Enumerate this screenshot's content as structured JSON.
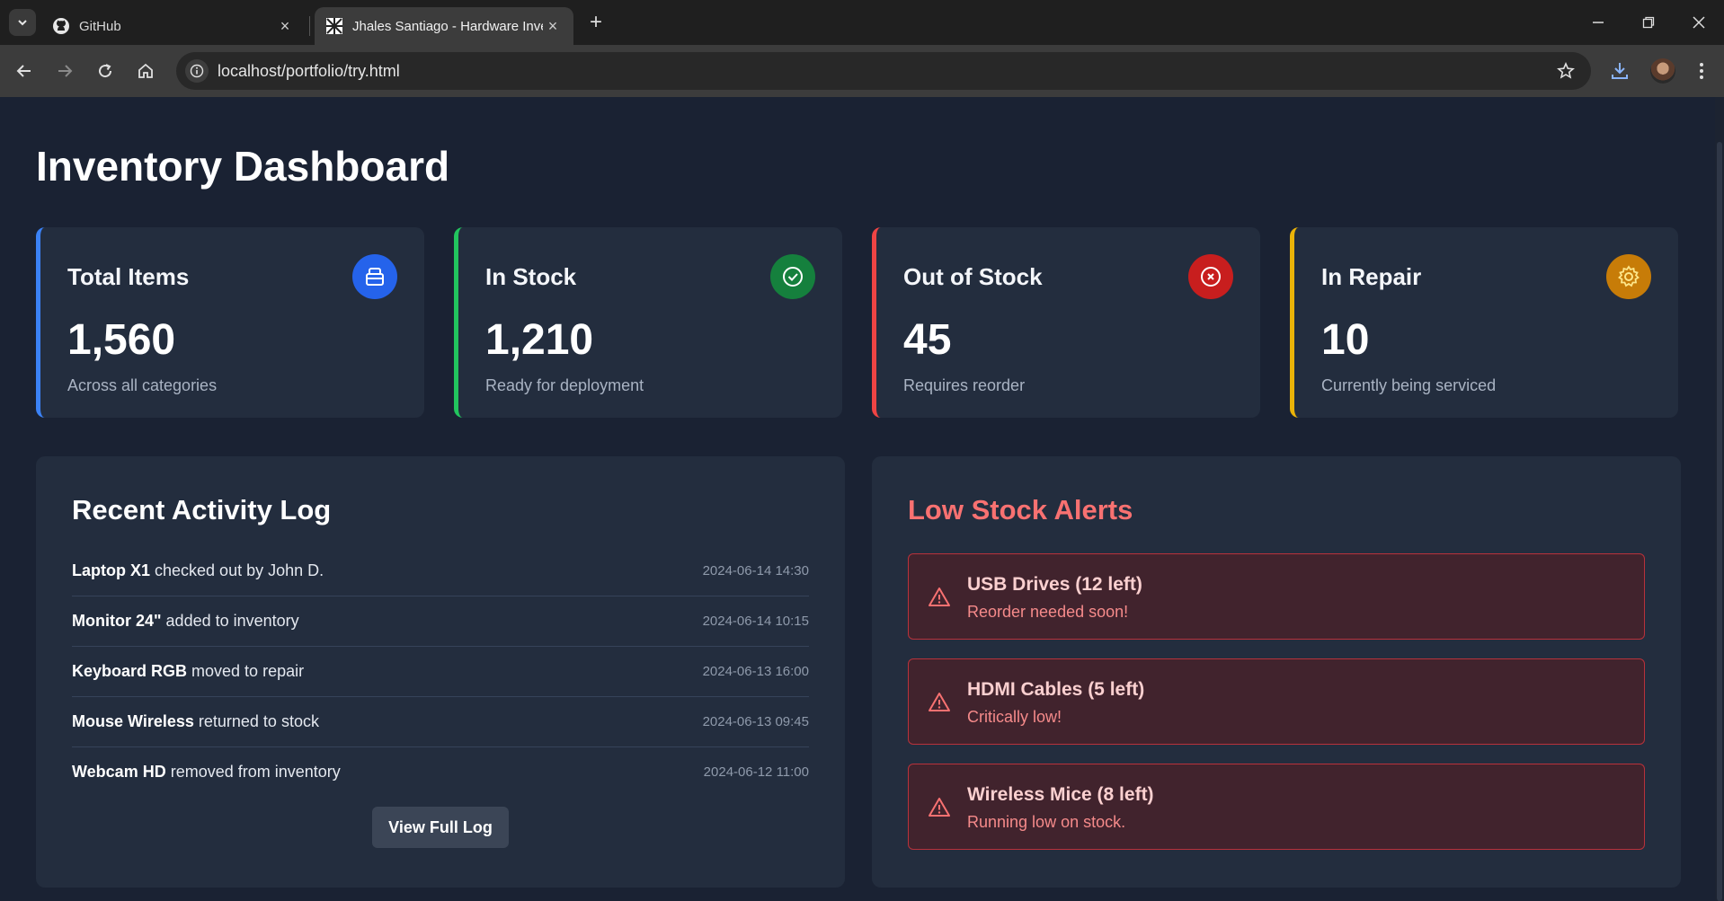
{
  "browser": {
    "tabs": [
      {
        "title": "GitHub",
        "active": false
      },
      {
        "title": "Jhales Santiago - Hardware Inve",
        "active": true
      }
    ],
    "url": "localhost/portfolio/try.html"
  },
  "page": {
    "title": "Inventory Dashboard"
  },
  "stats": [
    {
      "label": "Total Items",
      "value": "1,560",
      "sub": "Across all categories",
      "icon": "box-icon",
      "color": "#3b82f6",
      "icon_bg": "#2563eb"
    },
    {
      "label": "In Stock",
      "value": "1,210",
      "sub": "Ready for deployment",
      "icon": "check-circle-icon",
      "color": "#22c55e",
      "icon_bg": "#15803d"
    },
    {
      "label": "Out of Stock",
      "value": "45",
      "sub": "Requires reorder",
      "icon": "x-circle-icon",
      "color": "#ef4444",
      "icon_bg": "#c81e1e"
    },
    {
      "label": "In Repair",
      "value": "10",
      "sub": "Currently being serviced",
      "icon": "gear-icon",
      "color": "#eab308",
      "icon_bg": "#c77c08"
    }
  ],
  "activity": {
    "title": "Recent Activity Log",
    "entries": [
      {
        "item": "Laptop X1",
        "desc": " checked out by John D.",
        "time": "2024-06-14 14:30"
      },
      {
        "item": "Monitor 24\"",
        "desc": " added to inventory",
        "time": "2024-06-14 10:15"
      },
      {
        "item": "Keyboard RGB",
        "desc": " moved to repair",
        "time": "2024-06-13 16:00"
      },
      {
        "item": "Mouse Wireless",
        "desc": " returned to stock",
        "time": "2024-06-13 09:45"
      },
      {
        "item": "Webcam HD",
        "desc": " removed from inventory",
        "time": "2024-06-12 11:00"
      }
    ],
    "button_label": "View Full Log"
  },
  "alerts": {
    "title": "Low Stock Alerts",
    "items": [
      {
        "title": "USB Drives (12 left)",
        "message": "Reorder needed soon!"
      },
      {
        "title": "HDMI Cables (5 left)",
        "message": "Critically low!"
      },
      {
        "title": "Wireless Mice (8 left)",
        "message": "Running low on stock."
      }
    ]
  }
}
